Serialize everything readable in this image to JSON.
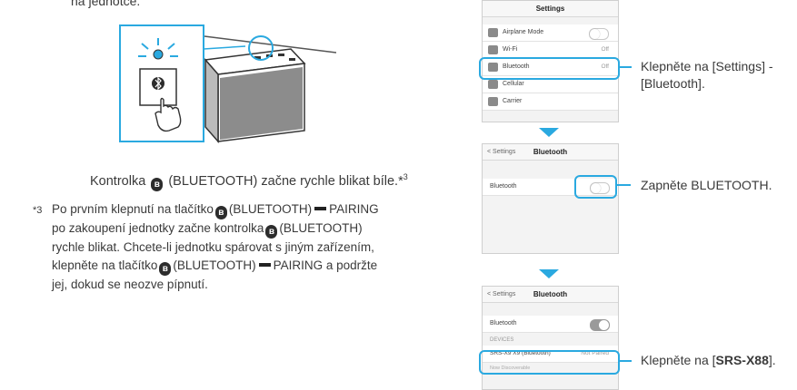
{
  "left": {
    "top_text": "na jednotce.",
    "caption_pre": "Kontrolka",
    "caption_post": "(BLUETOOTH) začne rychle blikat bíle.*",
    "caption_sup": "3",
    "footnote_mark": "*3",
    "footnote_l1_a": "Po prvním klepnutí na tlačítko",
    "footnote_l1_b": "(BLUETOOTH)",
    "footnote_l1_c": "PAIRING",
    "footnote_l2_a": "po zakoupení jednotky začne kontrolka",
    "footnote_l2_b": "(BLUETOOTH)",
    "footnote_l3": "rychle blikat. Chcete-li jednotku spárovat s jiným zařízením,",
    "footnote_l4_a": "klepněte na tlačítko",
    "footnote_l4_b": "(BLUETOOTH)",
    "footnote_l4_c": "PAIRING a podržte",
    "footnote_l5": "jej, dokud se neozve pípnutí.",
    "bt_glyph": "ʙ"
  },
  "screen1": {
    "title": "Settings",
    "rows": [
      {
        "label": "Airplane Mode",
        "value": ""
      },
      {
        "label": "Wi-Fi",
        "value": "Off"
      },
      {
        "label": "Bluetooth",
        "value": "Off"
      },
      {
        "label": "Cellular",
        "value": ""
      },
      {
        "label": "Carrier",
        "value": ""
      }
    ],
    "instruction": "Klepněte na [Settings] -",
    "instruction2": "[Bluetooth]."
  },
  "screen2": {
    "back": "< Settings",
    "title": "Bluetooth",
    "row_label": "Bluetooth",
    "instruction": "Zapněte BLUETOOTH."
  },
  "screen3": {
    "back": "< Settings",
    "title": "Bluetooth",
    "row_label": "Bluetooth",
    "devices_label": "DEVICES",
    "device_name": "SRS-X9 X9 (Bluetooth)",
    "device_status": "Not Paired",
    "footer": "Now Discoverable",
    "instruction_pre": "Klepněte na [",
    "instruction_bold": "SRS-X88",
    "instruction_post": "]."
  },
  "colors": {
    "accent": "#2aa9e0",
    "text": "#3a3a3a"
  }
}
